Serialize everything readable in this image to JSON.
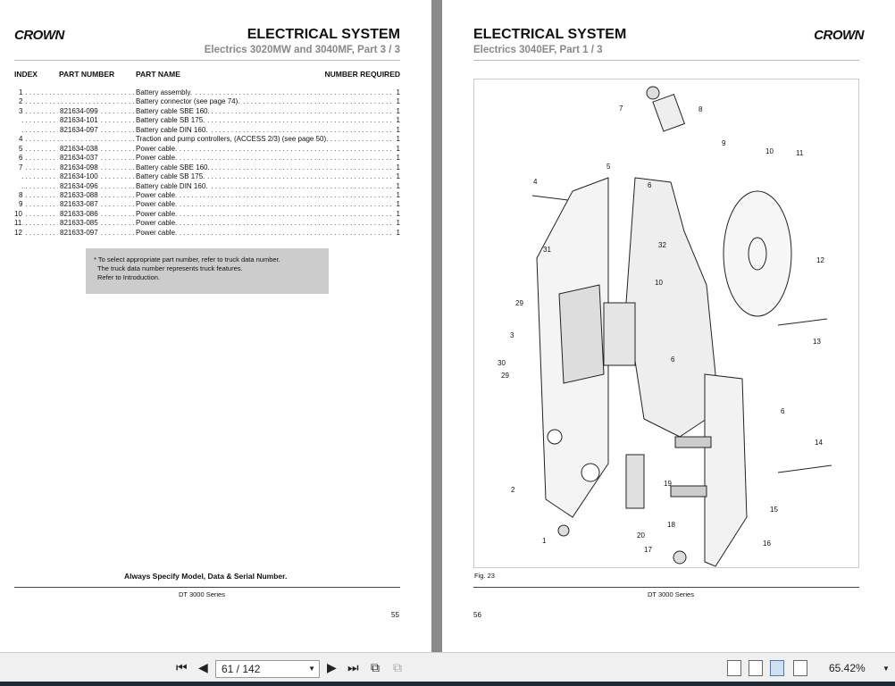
{
  "left_page": {
    "logo": "CROWN",
    "title": "ELECTRICAL SYSTEM",
    "subtitle": "Electrics 3020MW and 3040MF, Part 3 / 3",
    "columns": [
      "INDEX",
      "PART NUMBER",
      "PART NAME",
      "NUMBER REQUIRED"
    ],
    "rows": [
      {
        "index": "1",
        "part": "",
        "name": "Battery assembly.",
        "qty": "1"
      },
      {
        "index": "2",
        "part": "",
        "name": "Battery connector (see page 74).",
        "qty": "1"
      },
      {
        "index": "3",
        "part": "821634-099",
        "name": "Battery cable SBE 160.",
        "qty": "1"
      },
      {
        "index": "",
        "part": "821634-101",
        "name": "Battery cable SB 175.",
        "qty": "1"
      },
      {
        "index": "",
        "part": "821634-097",
        "name": "Battery cable DIN 160.",
        "qty": "1"
      },
      {
        "index": "4",
        "part": "",
        "name": "Traction and pump controllers, (ACCESS 2/3) (see page 50).",
        "qty": "1"
      },
      {
        "index": "5",
        "part": "821634-038",
        "name": "Power cable.",
        "qty": "1"
      },
      {
        "index": "6",
        "part": "821634-037",
        "name": "Power cable.",
        "qty": "1"
      },
      {
        "index": "7",
        "part": "821634-098",
        "name": "Battery cable SBE 160.",
        "qty": "1"
      },
      {
        "index": "",
        "part": "821634-100",
        "name": "Battery cable SB 175.",
        "qty": "1"
      },
      {
        "index": "",
        "part": "821634-096",
        "name": "Battery cable DIN 160.",
        "qty": "1"
      },
      {
        "index": "8",
        "part": "821633-088",
        "name": "Power cable.",
        "qty": "1"
      },
      {
        "index": "9",
        "part": "821633-087",
        "name": "Power cable.",
        "qty": "1"
      },
      {
        "index": "10",
        "part": "821633-086",
        "name": "Power cable.",
        "qty": "1"
      },
      {
        "index": "11",
        "part": "821633-085",
        "name": "Power cable.",
        "qty": "1"
      },
      {
        "index": "12",
        "part": "821633-097",
        "name": "Power cable.",
        "qty": "1"
      }
    ],
    "note": [
      "* To select appropriate part number, refer to truck data number.",
      "The truck data number represents truck features.",
      "Refer to Introduction."
    ],
    "specify": "Always Specify Model, Data & Serial Number.",
    "series": "DT 3000 Series",
    "page_number": "55"
  },
  "right_page": {
    "logo": "CROWN",
    "title": "ELECTRICAL SYSTEM",
    "subtitle": "Electrics 3040EF, Part 1 / 3",
    "figure_label": "Fig. 23",
    "callouts": [
      "7",
      "8",
      "9",
      "5",
      "4",
      "6",
      "10",
      "11",
      "12",
      "31",
      "32",
      "10",
      "29",
      "3",
      "30",
      "29",
      "6",
      "13",
      "6",
      "14",
      "19",
      "2",
      "15",
      "18",
      "20",
      "1",
      "16",
      "17"
    ],
    "series": "DT 3000 Series",
    "page_number": "56"
  },
  "toolbar": {
    "page_input": "61 / 142",
    "zoom": "65.42%",
    "active_view": "two-page"
  }
}
